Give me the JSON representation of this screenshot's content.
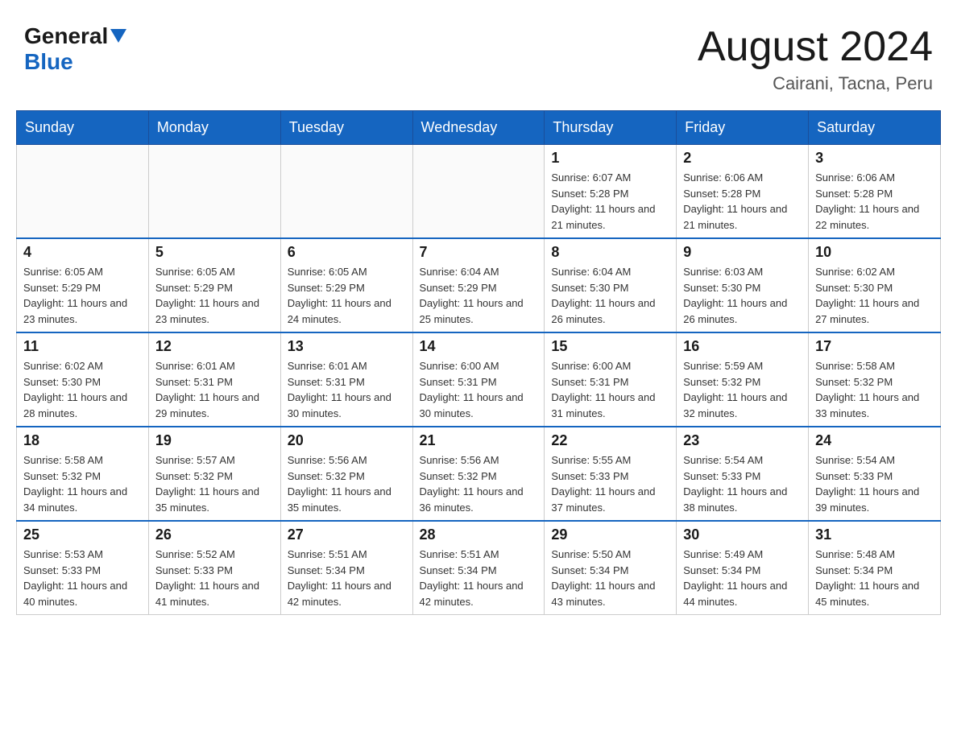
{
  "header": {
    "logo_general": "General",
    "logo_blue": "Blue",
    "main_title": "August 2024",
    "subtitle": "Cairani, Tacna, Peru"
  },
  "days_of_week": [
    "Sunday",
    "Monday",
    "Tuesday",
    "Wednesday",
    "Thursday",
    "Friday",
    "Saturday"
  ],
  "weeks": [
    [
      {
        "day": "",
        "sunrise": "",
        "sunset": "",
        "daylight": ""
      },
      {
        "day": "",
        "sunrise": "",
        "sunset": "",
        "daylight": ""
      },
      {
        "day": "",
        "sunrise": "",
        "sunset": "",
        "daylight": ""
      },
      {
        "day": "",
        "sunrise": "",
        "sunset": "",
        "daylight": ""
      },
      {
        "day": "1",
        "sunrise": "Sunrise: 6:07 AM",
        "sunset": "Sunset: 5:28 PM",
        "daylight": "Daylight: 11 hours and 21 minutes."
      },
      {
        "day": "2",
        "sunrise": "Sunrise: 6:06 AM",
        "sunset": "Sunset: 5:28 PM",
        "daylight": "Daylight: 11 hours and 21 minutes."
      },
      {
        "day": "3",
        "sunrise": "Sunrise: 6:06 AM",
        "sunset": "Sunset: 5:28 PM",
        "daylight": "Daylight: 11 hours and 22 minutes."
      }
    ],
    [
      {
        "day": "4",
        "sunrise": "Sunrise: 6:05 AM",
        "sunset": "Sunset: 5:29 PM",
        "daylight": "Daylight: 11 hours and 23 minutes."
      },
      {
        "day": "5",
        "sunrise": "Sunrise: 6:05 AM",
        "sunset": "Sunset: 5:29 PM",
        "daylight": "Daylight: 11 hours and 23 minutes."
      },
      {
        "day": "6",
        "sunrise": "Sunrise: 6:05 AM",
        "sunset": "Sunset: 5:29 PM",
        "daylight": "Daylight: 11 hours and 24 minutes."
      },
      {
        "day": "7",
        "sunrise": "Sunrise: 6:04 AM",
        "sunset": "Sunset: 5:29 PM",
        "daylight": "Daylight: 11 hours and 25 minutes."
      },
      {
        "day": "8",
        "sunrise": "Sunrise: 6:04 AM",
        "sunset": "Sunset: 5:30 PM",
        "daylight": "Daylight: 11 hours and 26 minutes."
      },
      {
        "day": "9",
        "sunrise": "Sunrise: 6:03 AM",
        "sunset": "Sunset: 5:30 PM",
        "daylight": "Daylight: 11 hours and 26 minutes."
      },
      {
        "day": "10",
        "sunrise": "Sunrise: 6:02 AM",
        "sunset": "Sunset: 5:30 PM",
        "daylight": "Daylight: 11 hours and 27 minutes."
      }
    ],
    [
      {
        "day": "11",
        "sunrise": "Sunrise: 6:02 AM",
        "sunset": "Sunset: 5:30 PM",
        "daylight": "Daylight: 11 hours and 28 minutes."
      },
      {
        "day": "12",
        "sunrise": "Sunrise: 6:01 AM",
        "sunset": "Sunset: 5:31 PM",
        "daylight": "Daylight: 11 hours and 29 minutes."
      },
      {
        "day": "13",
        "sunrise": "Sunrise: 6:01 AM",
        "sunset": "Sunset: 5:31 PM",
        "daylight": "Daylight: 11 hours and 30 minutes."
      },
      {
        "day": "14",
        "sunrise": "Sunrise: 6:00 AM",
        "sunset": "Sunset: 5:31 PM",
        "daylight": "Daylight: 11 hours and 30 minutes."
      },
      {
        "day": "15",
        "sunrise": "Sunrise: 6:00 AM",
        "sunset": "Sunset: 5:31 PM",
        "daylight": "Daylight: 11 hours and 31 minutes."
      },
      {
        "day": "16",
        "sunrise": "Sunrise: 5:59 AM",
        "sunset": "Sunset: 5:32 PM",
        "daylight": "Daylight: 11 hours and 32 minutes."
      },
      {
        "day": "17",
        "sunrise": "Sunrise: 5:58 AM",
        "sunset": "Sunset: 5:32 PM",
        "daylight": "Daylight: 11 hours and 33 minutes."
      }
    ],
    [
      {
        "day": "18",
        "sunrise": "Sunrise: 5:58 AM",
        "sunset": "Sunset: 5:32 PM",
        "daylight": "Daylight: 11 hours and 34 minutes."
      },
      {
        "day": "19",
        "sunrise": "Sunrise: 5:57 AM",
        "sunset": "Sunset: 5:32 PM",
        "daylight": "Daylight: 11 hours and 35 minutes."
      },
      {
        "day": "20",
        "sunrise": "Sunrise: 5:56 AM",
        "sunset": "Sunset: 5:32 PM",
        "daylight": "Daylight: 11 hours and 35 minutes."
      },
      {
        "day": "21",
        "sunrise": "Sunrise: 5:56 AM",
        "sunset": "Sunset: 5:32 PM",
        "daylight": "Daylight: 11 hours and 36 minutes."
      },
      {
        "day": "22",
        "sunrise": "Sunrise: 5:55 AM",
        "sunset": "Sunset: 5:33 PM",
        "daylight": "Daylight: 11 hours and 37 minutes."
      },
      {
        "day": "23",
        "sunrise": "Sunrise: 5:54 AM",
        "sunset": "Sunset: 5:33 PM",
        "daylight": "Daylight: 11 hours and 38 minutes."
      },
      {
        "day": "24",
        "sunrise": "Sunrise: 5:54 AM",
        "sunset": "Sunset: 5:33 PM",
        "daylight": "Daylight: 11 hours and 39 minutes."
      }
    ],
    [
      {
        "day": "25",
        "sunrise": "Sunrise: 5:53 AM",
        "sunset": "Sunset: 5:33 PM",
        "daylight": "Daylight: 11 hours and 40 minutes."
      },
      {
        "day": "26",
        "sunrise": "Sunrise: 5:52 AM",
        "sunset": "Sunset: 5:33 PM",
        "daylight": "Daylight: 11 hours and 41 minutes."
      },
      {
        "day": "27",
        "sunrise": "Sunrise: 5:51 AM",
        "sunset": "Sunset: 5:34 PM",
        "daylight": "Daylight: 11 hours and 42 minutes."
      },
      {
        "day": "28",
        "sunrise": "Sunrise: 5:51 AM",
        "sunset": "Sunset: 5:34 PM",
        "daylight": "Daylight: 11 hours and 42 minutes."
      },
      {
        "day": "29",
        "sunrise": "Sunrise: 5:50 AM",
        "sunset": "Sunset: 5:34 PM",
        "daylight": "Daylight: 11 hours and 43 minutes."
      },
      {
        "day": "30",
        "sunrise": "Sunrise: 5:49 AM",
        "sunset": "Sunset: 5:34 PM",
        "daylight": "Daylight: 11 hours and 44 minutes."
      },
      {
        "day": "31",
        "sunrise": "Sunrise: 5:48 AM",
        "sunset": "Sunset: 5:34 PM",
        "daylight": "Daylight: 11 hours and 45 minutes."
      }
    ]
  ]
}
